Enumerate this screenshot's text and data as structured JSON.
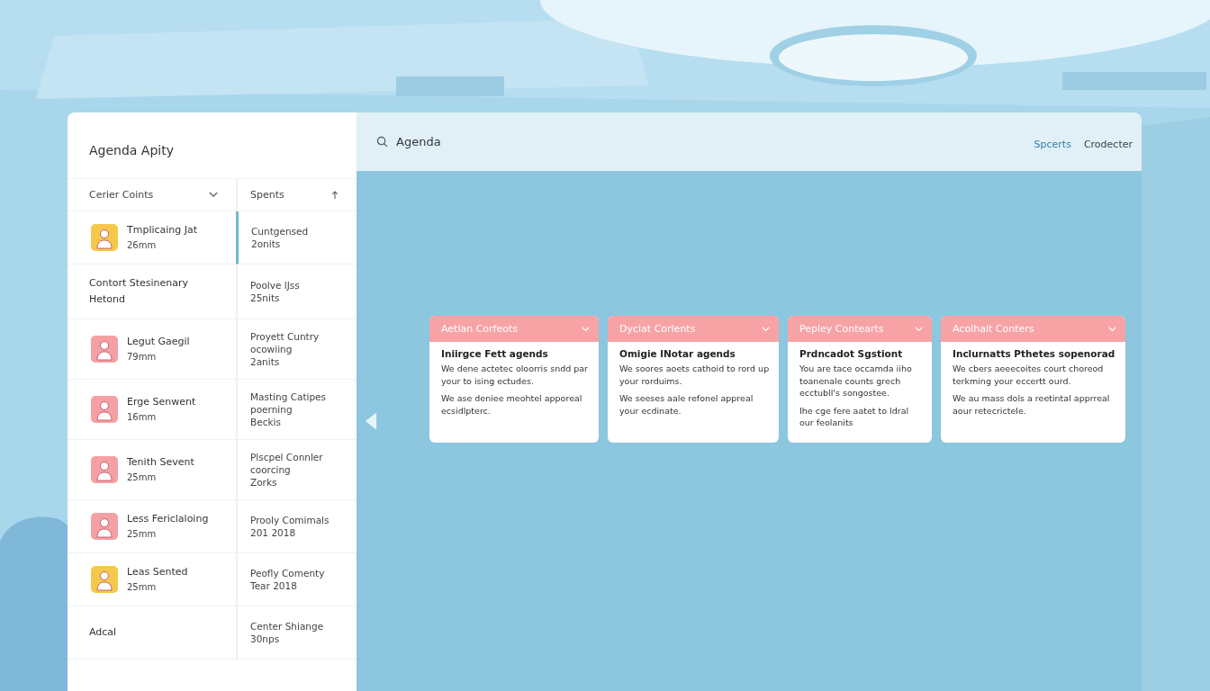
{
  "sidebar": {
    "title": "Agenda Apity",
    "columns": [
      {
        "label": "Cerier Coints"
      },
      {
        "label": "Spents"
      }
    ],
    "rows": [
      {
        "selected": true,
        "color": "#f5c84c",
        "name": "Tmplicaing Jat",
        "detail": "26mm",
        "lines": [
          "Cuntgensed",
          "2onits"
        ]
      },
      {
        "selected": false,
        "name": "Contort Stesinenary",
        "name_line_2": "Hetond",
        "lines": [
          "Poolve lJss",
          "25nits"
        ]
      },
      {
        "selected": false,
        "color": "#f4a0a4",
        "name": "Legut Gaegil",
        "detail": "79mm",
        "lines": [
          "Proyett Cuntry",
          "ocowiing",
          "2anits"
        ]
      },
      {
        "selected": false,
        "color": "#f4a0a4",
        "name": "Erge Senwent",
        "detail": "16mm",
        "lines": [
          "Masting Catipes",
          "poerning",
          "Beckis"
        ]
      },
      {
        "selected": false,
        "color": "#f4a0a4",
        "name": "Tenith Sevent",
        "detail": "25mm",
        "lines": [
          "Plscpel Connler",
          "coorcing",
          "Zorks"
        ]
      },
      {
        "selected": false,
        "color": "#f4a0a4",
        "name": "Less Fericlaloing",
        "detail": "25mm",
        "lines": [
          "Prooly Comimals",
          "201 2018"
        ]
      },
      {
        "selected": false,
        "color": "#f5c84c",
        "name": "Leas Sented",
        "detail": "25mm",
        "lines": [
          "Peofly Comenty",
          "Tear 2018"
        ]
      },
      {
        "selected": false,
        "name": "Adcal",
        "lines": [
          "Center Shiange",
          "30nps"
        ]
      }
    ]
  },
  "topbar": {
    "search": {
      "value": "Agenda"
    },
    "links": [
      "Spcerts",
      "Crodecter"
    ]
  },
  "cards": [
    {
      "title": "Aetlan Corfeots",
      "heading": "Iniirgce Fett agends",
      "paragraphs": [
        "We dene actetec oloorris sndd par your to ising ectudes.",
        "We ase deniee meohtel apporeal ecsidlpterc."
      ]
    },
    {
      "title": "Dyciat Corlents",
      "heading": "Omigie lNotar agends",
      "paragraphs": [
        "We soores aoets cathoid to rord up your rorduims.",
        "We seeses aale refonel appreal your ecdinate."
      ]
    },
    {
      "title": "Pepley Contearts",
      "heading": "Prdncadot Sgstiont",
      "paragraphs": [
        "You are tace occamda iiho toanenale counts grech ecctubll's songostee.",
        "Ihe cge fere aatet to ldral our feolanits"
      ]
    },
    {
      "title": "Acolhalt Conters",
      "heading": "Inclurnatts Pthetes sopenorad",
      "paragraphs": [
        "We cbers aeeecoites court choreod terkming your eccertt ourd.",
        "We au mass dols a reetintal apprreal aour retecrictele."
      ]
    }
  ]
}
